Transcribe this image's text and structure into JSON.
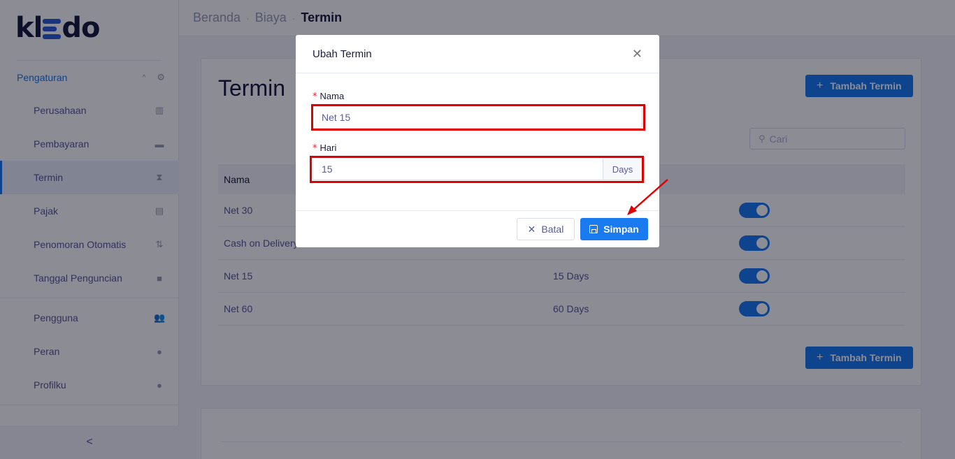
{
  "brand": {
    "logo_left": "kl",
    "logo_right": "do"
  },
  "sidebar": {
    "group_label": "Pengaturan",
    "items": [
      {
        "label": "Perusahaan",
        "icon": "building-icon"
      },
      {
        "label": "Pembayaran",
        "icon": "credit-card-icon"
      },
      {
        "label": "Termin",
        "icon": "hourglass-icon",
        "active": true
      },
      {
        "label": "Pajak",
        "icon": "id-card-icon"
      },
      {
        "label": "Penomoran Otomatis",
        "icon": "sort-icon"
      },
      {
        "label": "Tanggal Penguncian",
        "icon": "lock-icon"
      }
    ],
    "items2": [
      {
        "label": "Pengguna",
        "icon": "users-icon"
      },
      {
        "label": "Peran",
        "icon": "user-lock-icon"
      },
      {
        "label": "Profilku",
        "icon": "user-icon"
      }
    ],
    "collapse_glyph": "<"
  },
  "breadcrumb": {
    "home": "Beranda",
    "parent": "Biaya",
    "current": "Termin",
    "separator": "·"
  },
  "page": {
    "title": "Termin",
    "add_button": "Tambah Termin",
    "search_placeholder": "Cari",
    "table": {
      "header_name": "Nama",
      "rows": [
        {
          "name": "Net 30",
          "days": "",
          "enabled": true
        },
        {
          "name": "Cash on Delivery",
          "days": "",
          "enabled": true
        },
        {
          "name": "Net 15",
          "days": "15 Days",
          "enabled": true
        },
        {
          "name": "Net 60",
          "days": "60 Days",
          "enabled": true
        }
      ]
    }
  },
  "modal": {
    "title": "Ubah Termin",
    "name_label": "Nama",
    "name_value": "Net 15",
    "days_label": "Hari",
    "days_value": "15",
    "days_addon": "Days",
    "cancel_label": "Batal",
    "save_label": "Simpan"
  },
  "colors": {
    "accent": "#1a7bf0",
    "highlight": "#e00000",
    "required": "#f5222d"
  }
}
